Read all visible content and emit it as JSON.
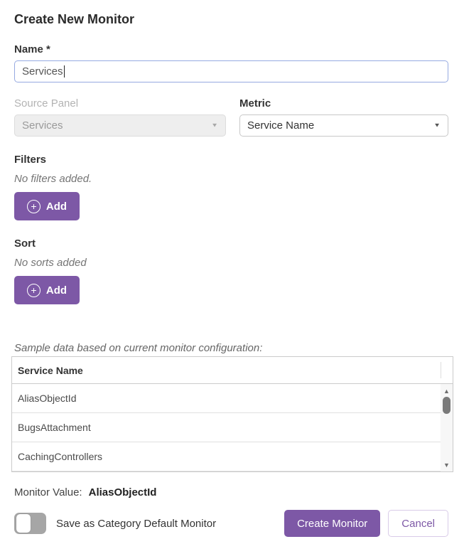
{
  "colors": {
    "accent_purple": "#7d58a6",
    "focus_border_blue": "#96aae1",
    "disabled_gray": "#eeeeee"
  },
  "title": "Create New Monitor",
  "name_field": {
    "label": "Name *",
    "value": "Services"
  },
  "source_panel": {
    "label": "Source Panel",
    "value": "Services",
    "state": "disabled"
  },
  "metric": {
    "label": "Metric",
    "value": "Service Name"
  },
  "filters": {
    "label": "Filters",
    "empty_text": "No filters added.",
    "add_label": "Add"
  },
  "sort": {
    "label": "Sort",
    "empty_text": "No sorts added",
    "add_label": "Add"
  },
  "sample": {
    "caption": "Sample data based on current monitor configuration:",
    "table": {
      "columns": [
        "Service Name"
      ],
      "rows": [
        "AliasObjectId",
        "BugsAttachment",
        "CachingControllers"
      ]
    }
  },
  "monitor_value": {
    "label": "Monitor Value:",
    "value": "AliasObjectId"
  },
  "footer": {
    "toggle_label": "Save as Category Default Monitor",
    "toggle_state": "off",
    "create_label": "Create Monitor",
    "cancel_label": "Cancel"
  },
  "icons": {
    "plus": "+",
    "dropdown_chevron": "▼",
    "scroll_up": "▲",
    "scroll_down": "▼"
  }
}
